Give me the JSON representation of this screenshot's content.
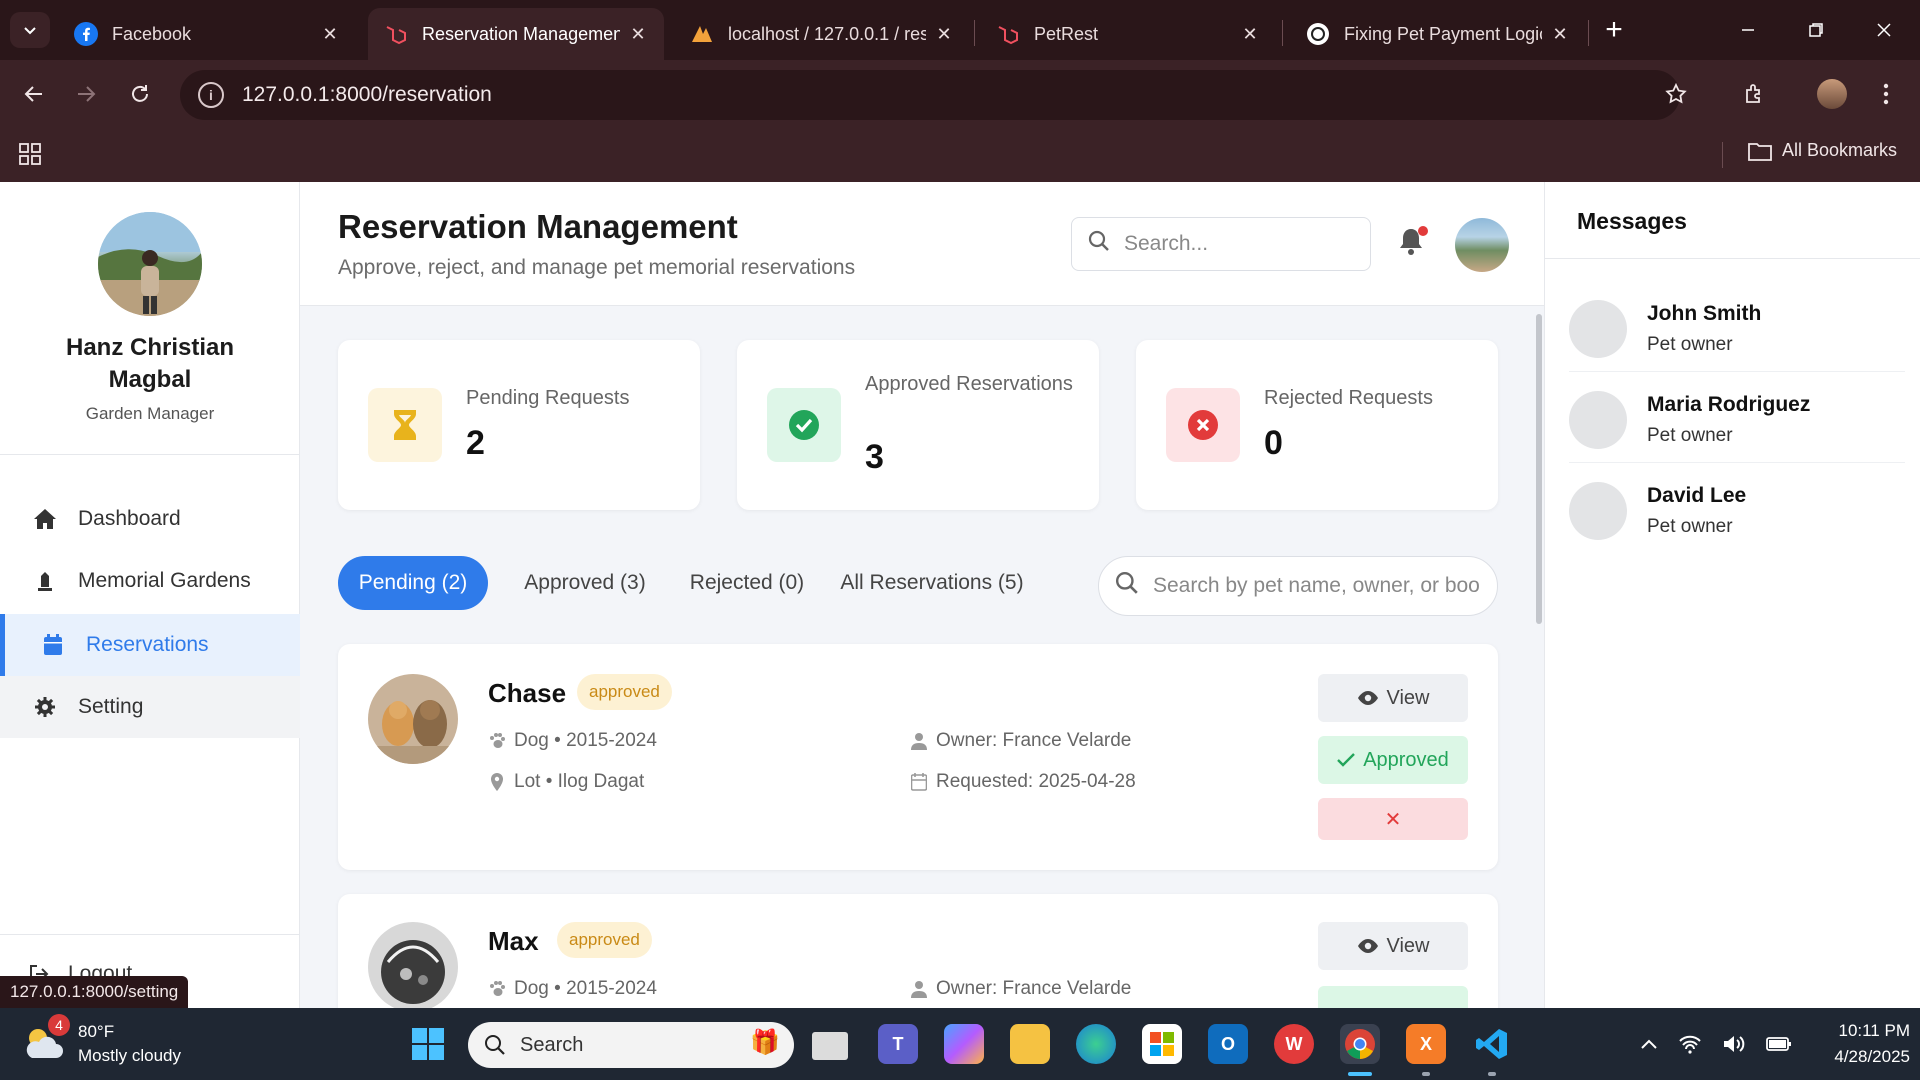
{
  "browser": {
    "tabs": [
      {
        "title": "Facebook",
        "favicon": "facebook-icon",
        "active": false
      },
      {
        "title": "Reservation Managemen",
        "favicon": "laravel-icon",
        "active": true
      },
      {
        "title": "localhost / 127.0.0.1 / res",
        "favicon": "phpmyadmin-icon",
        "active": false
      },
      {
        "title": "PetRest",
        "favicon": "laravel-icon",
        "active": false
      },
      {
        "title": "Fixing Pet Payment Logic",
        "favicon": "chatgpt-icon",
        "active": false
      }
    ],
    "url": "127.0.0.1:8000/reservation",
    "all_bookmarks": "All Bookmarks",
    "status_url": "127.0.0.1:8000/setting"
  },
  "sidebar": {
    "user_name": "Hanz Christian Magbal",
    "user_role": "Garden Manager",
    "items": [
      {
        "label": "Dashboard",
        "icon": "home-icon"
      },
      {
        "label": "Memorial Gardens",
        "icon": "monument-icon"
      },
      {
        "label": "Reservations",
        "icon": "calendar-icon"
      },
      {
        "label": "Setting",
        "icon": "gear-icon"
      }
    ],
    "logout": "Logout"
  },
  "header": {
    "title": "Reservation Management",
    "subtitle": "Approve, reject, and manage pet memorial reservations",
    "search_placeholder": "Search..."
  },
  "stats": [
    {
      "label": "Pending Requests",
      "value": "2",
      "icon": "hourglass-icon",
      "color": "#e8b31c"
    },
    {
      "label": "Approved Reservations",
      "value": "3",
      "icon": "check-circle-icon",
      "color": "#22a55a"
    },
    {
      "label": "Rejected Requests",
      "value": "0",
      "icon": "x-circle-icon",
      "color": "#e23b3b"
    }
  ],
  "filter_tabs": [
    {
      "label": "Pending (2)",
      "active": true
    },
    {
      "label": "Approved (3)"
    },
    {
      "label": "Rejected (0)"
    },
    {
      "label": "All Reservations (5)"
    }
  ],
  "reservation_search_placeholder": "Search by pet name, owner, or boo",
  "reservations": [
    {
      "pet": "Chase",
      "status": "approved",
      "species_years": "Dog • 2015-2024",
      "location": "Lot • Ilog Dagat",
      "owner": "Owner: France Velarde",
      "requested": "Requested: 2025-04-28",
      "view_label": "View",
      "approved_label": "Approved",
      "reject_label": "✕"
    },
    {
      "pet": "Max",
      "status": "approved",
      "species_years": "Dog • 2015-2024",
      "owner": "Owner: France Velarde",
      "view_label": "View"
    }
  ],
  "messages": {
    "title": "Messages",
    "items": [
      {
        "name": "John Smith",
        "role": "Pet owner"
      },
      {
        "name": "Maria Rodriguez",
        "role": "Pet owner"
      },
      {
        "name": "David Lee",
        "role": "Pet owner"
      }
    ]
  },
  "taskbar": {
    "weather_temp": "80°F",
    "weather_desc": "Mostly cloudy",
    "weather_badge": "4",
    "search_label": "Search",
    "time": "10:11 PM",
    "date": "4/28/2025"
  },
  "colors": {
    "accent": "#2f7bea",
    "chrome_bg": "#3b2226",
    "pending": "#e8b31c",
    "approved": "#22a55a",
    "rejected": "#e23b3b"
  }
}
